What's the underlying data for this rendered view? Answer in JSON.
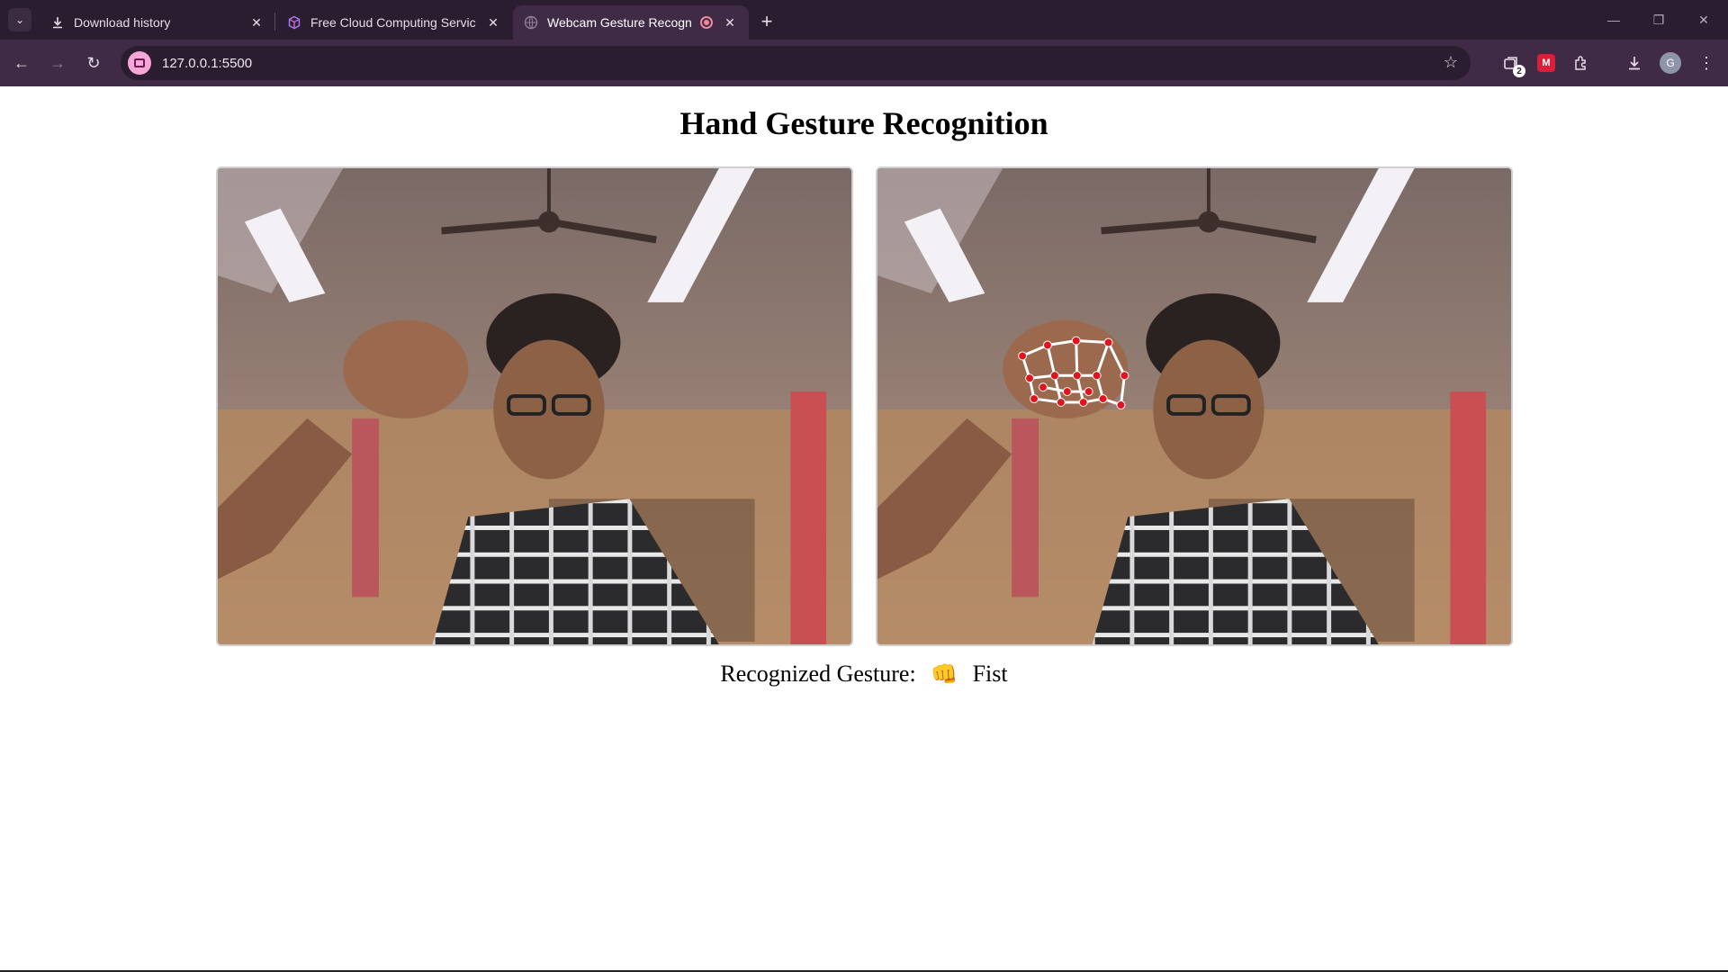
{
  "browser": {
    "tabs": [
      {
        "title": "Download history",
        "icon": "download-icon",
        "active": false
      },
      {
        "title": "Free Cloud Computing Services",
        "icon": "cube-icon",
        "active": false
      },
      {
        "title": "Webcam Gesture Recogniti",
        "icon": "globe-icon",
        "active": true,
        "recording": true
      }
    ],
    "url": "127.0.0.1:5500",
    "extension_badge": "2",
    "profile_initial": "G"
  },
  "page": {
    "title": "Hand Gesture Recognition",
    "gesture_label": "Recognized Gesture:",
    "gesture_emoji": "👊",
    "gesture_name": "Fist"
  },
  "colors": {
    "tabstrip": "#2a1d2f",
    "toolbar": "#3f2b45",
    "landmark_point": "#e0141e",
    "landmark_line": "#ffffff"
  }
}
